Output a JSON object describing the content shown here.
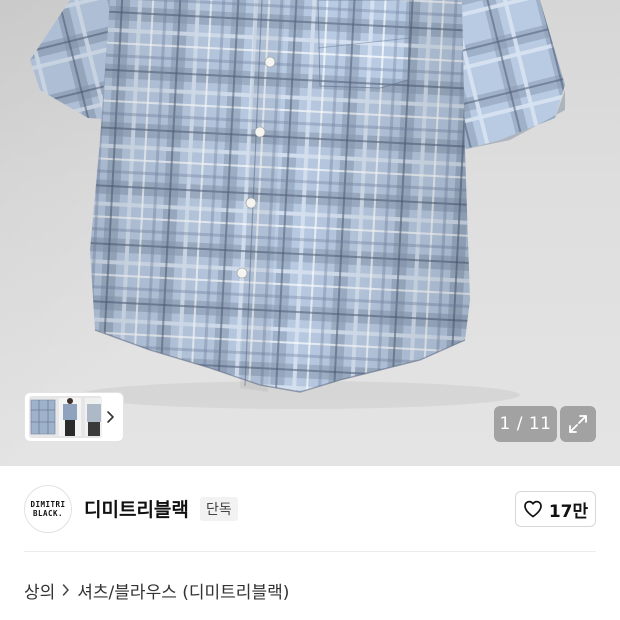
{
  "gallery": {
    "current": "1",
    "total": "11",
    "counter_text": "1 / 11",
    "thumbnail_icon": "thumbnail-strip",
    "next_icon": "chevron-right-icon",
    "expand_icon": "expand-icon"
  },
  "brand": {
    "logo_line1": "DIMITRI",
    "logo_line2": "BLACK.",
    "name": "디미트리블랙",
    "tag": "단독"
  },
  "like": {
    "icon": "heart-icon",
    "count": "17만"
  },
  "breadcrumb": {
    "level1": "상의",
    "level2": "셔츠/블라우스 (디미트리블랙)"
  },
  "colors": {
    "shirt_base": "#a9bcd6",
    "shirt_dark": "#5e6f8c",
    "overlay": "#6e6e6e"
  }
}
